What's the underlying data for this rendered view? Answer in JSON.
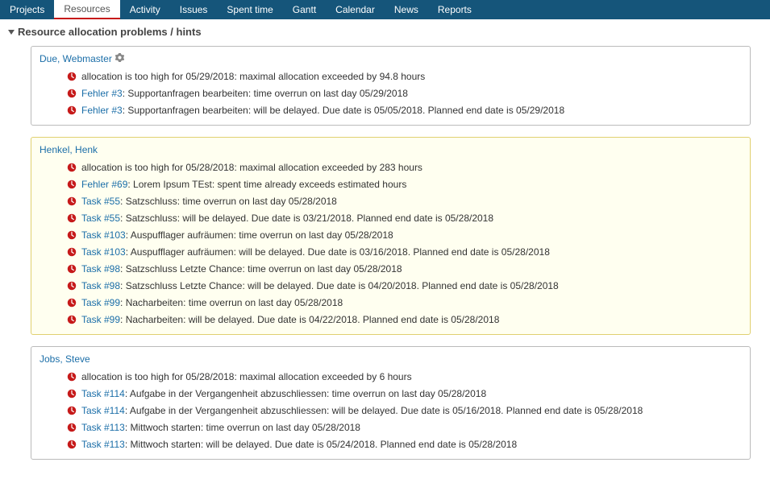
{
  "nav": {
    "items": [
      "Projects",
      "Resources",
      "Activity",
      "Issues",
      "Spent time",
      "Gantt",
      "Calendar",
      "News",
      "Reports"
    ],
    "active_index": 1
  },
  "section_title": "Resource allocation problems / hints",
  "users": [
    {
      "name": "Due, Webmaster",
      "show_gear": true,
      "highlight": false,
      "hints": [
        {
          "issue": null,
          "text": "allocation is too high for 05/29/2018: maximal allocation exceeded by 94.8 hours"
        },
        {
          "issue": "Fehler #3",
          "text": "Supportanfragen bearbeiten: time overrun on last day 05/29/2018"
        },
        {
          "issue": "Fehler #3",
          "text": "Supportanfragen bearbeiten: will be delayed. Due date is 05/05/2018. Planned end date is 05/29/2018"
        }
      ]
    },
    {
      "name": "Henkel, Henk",
      "show_gear": false,
      "highlight": true,
      "hints": [
        {
          "issue": null,
          "text": "allocation is too high for 05/28/2018: maximal allocation exceeded by 283 hours"
        },
        {
          "issue": "Fehler #69",
          "text": "Lorem Ipsum TEst: spent time already exceeds estimated hours"
        },
        {
          "issue": "Task #55",
          "text": "Satzschluss: time overrun on last day 05/28/2018"
        },
        {
          "issue": "Task #55",
          "text": "Satzschluss: will be delayed. Due date is 03/21/2018. Planned end date is 05/28/2018"
        },
        {
          "issue": "Task #103",
          "text": "Auspufflager aufräumen: time overrun on last day 05/28/2018"
        },
        {
          "issue": "Task #103",
          "text": "Auspufflager aufräumen: will be delayed. Due date is 03/16/2018. Planned end date is 05/28/2018"
        },
        {
          "issue": "Task #98",
          "text": "Satzschluss Letzte Chance: time overrun on last day 05/28/2018"
        },
        {
          "issue": "Task #98",
          "text": "Satzschluss Letzte Chance: will be delayed. Due date is 04/20/2018. Planned end date is 05/28/2018"
        },
        {
          "issue": "Task #99",
          "text": "Nacharbeiten: time overrun on last day 05/28/2018"
        },
        {
          "issue": "Task #99",
          "text": "Nacharbeiten: will be delayed. Due date is 04/22/2018. Planned end date is 05/28/2018"
        }
      ]
    },
    {
      "name": "Jobs, Steve",
      "show_gear": false,
      "highlight": false,
      "hints": [
        {
          "issue": null,
          "text": "allocation is too high for 05/28/2018: maximal allocation exceeded by 6 hours"
        },
        {
          "issue": "Task #114",
          "text": "Aufgabe in der Vergangenheit abzuschliessen: time overrun on last day 05/28/2018"
        },
        {
          "issue": "Task #114",
          "text": "Aufgabe in der Vergangenheit abzuschliessen: will be delayed. Due date is 05/16/2018. Planned end date is 05/28/2018"
        },
        {
          "issue": "Task #113",
          "text": "Mittwoch starten: time overrun on last day 05/28/2018"
        },
        {
          "issue": "Task #113",
          "text": "Mittwoch starten: will be delayed. Due date is 05/24/2018. Planned end date is 05/28/2018"
        }
      ]
    }
  ]
}
